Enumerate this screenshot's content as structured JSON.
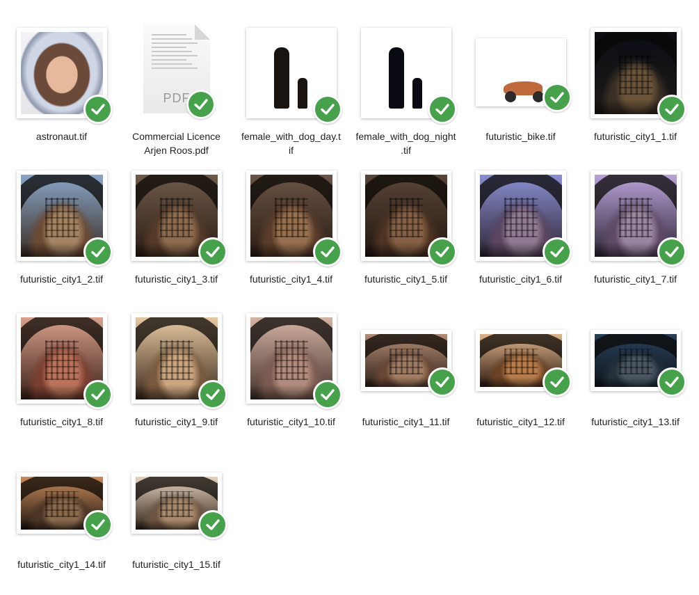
{
  "files": [
    {
      "name": "astronaut.tif",
      "kind": "astronaut",
      "status": "synced"
    },
    {
      "name": "Commercial Licence\nArjen Roos.pdf",
      "kind": "pdf",
      "status": "synced",
      "badge_text": "PDF"
    },
    {
      "name": "female_with_dog_day.t\nif",
      "kind": "figure-day",
      "status": "synced"
    },
    {
      "name": "female_with_dog_night\n.tif",
      "kind": "figure-night",
      "status": "synced"
    },
    {
      "name": "futuristic_bike.tif",
      "kind": "bike",
      "status": "synced"
    },
    {
      "name": "futuristic_city1_1.tif",
      "kind": "city",
      "status": "synced",
      "palette": [
        "#0b0d14",
        "#1d1a17",
        "#3a2f24",
        "#6a5338"
      ]
    },
    {
      "name": "futuristic_city1_2.tif",
      "kind": "city",
      "status": "synced",
      "palette": [
        "#8aa6c9",
        "#3a2d22",
        "#6b4a33",
        "#a58463"
      ]
    },
    {
      "name": "futuristic_city1_3.tif",
      "kind": "city",
      "status": "synced",
      "palette": [
        "#6f5a48",
        "#2a1d15",
        "#553a28",
        "#8e6b4c"
      ]
    },
    {
      "name": "futuristic_city1_4.tif",
      "kind": "city",
      "status": "synced",
      "palette": [
        "#6a5445",
        "#2b1c14",
        "#5b3c2a",
        "#97704f"
      ]
    },
    {
      "name": "futuristic_city1_5.tif",
      "kind": "city",
      "status": "synced",
      "palette": [
        "#5a4538",
        "#22170f",
        "#4e3322",
        "#856044"
      ]
    },
    {
      "name": "futuristic_city1_6.tif",
      "kind": "city",
      "status": "synced",
      "palette": [
        "#8a8fd1",
        "#2e2535",
        "#5a4660",
        "#8f7c92"
      ]
    },
    {
      "name": "futuristic_city1_7.tif",
      "kind": "city",
      "status": "synced",
      "palette": [
        "#b9a3d8",
        "#2f2638",
        "#5e4a66",
        "#9a86a2"
      ]
    },
    {
      "name": "futuristic_city1_8.tif",
      "kind": "city",
      "status": "synced",
      "palette": [
        "#d9a08a",
        "#3a2019",
        "#7b3f31",
        "#b9735a"
      ]
    },
    {
      "name": "futuristic_city1_9.tif",
      "kind": "city",
      "status": "synced",
      "palette": [
        "#e7c9a2",
        "#3c2a1d",
        "#7a5a3f",
        "#c9a47d"
      ]
    },
    {
      "name": "futuristic_city1_10.tif",
      "kind": "city",
      "status": "synced",
      "palette": [
        "#d5b3a3",
        "#42302a",
        "#7c5c52",
        "#b18c7c"
      ]
    },
    {
      "name": "futuristic_city1_11.tif",
      "kind": "city",
      "status": "synced",
      "palette": [
        "#b48c74",
        "#2e2019",
        "#684634",
        "#a27c62"
      ]
    },
    {
      "name": "futuristic_city1_12.tif",
      "kind": "city",
      "status": "synced",
      "palette": [
        "#e0b48a",
        "#2a1a10",
        "#6a4224",
        "#b57b4b"
      ]
    },
    {
      "name": "futuristic_city1_13.tif",
      "kind": "city",
      "status": "synced",
      "palette": [
        "#28405a",
        "#0f141a",
        "#24303a",
        "#4a5662"
      ]
    },
    {
      "name": "futuristic_city1_14.tif",
      "kind": "city",
      "status": "synced",
      "palette": [
        "#c88a5a",
        "#1c140e",
        "#4a3526",
        "#8a6a4d"
      ]
    },
    {
      "name": "futuristic_city1_15.tif",
      "kind": "city",
      "status": "synced",
      "palette": [
        "#e7d2bd",
        "#2e2218",
        "#6b5440",
        "#a9896b"
      ]
    }
  ],
  "colors": {
    "badge": "#46a24a",
    "label": "#1f1f1f"
  }
}
